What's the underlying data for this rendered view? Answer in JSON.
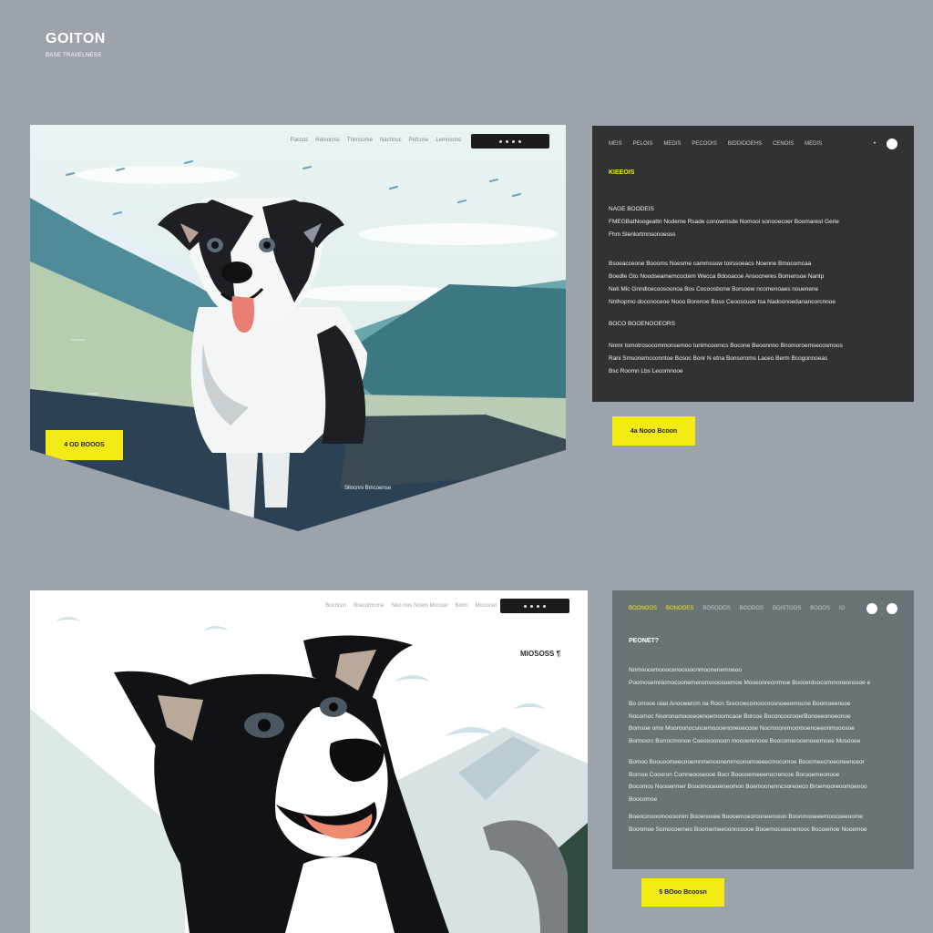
{
  "brand": {
    "title": "GOITON",
    "subtitle": "BASE TRAVELNESS"
  },
  "hero_top": {
    "nav": [
      "Pacsos",
      "Retsomss",
      "Thimsome",
      "Nachnuc",
      "Pefcose",
      "Lemnsons"
    ],
    "cta": "4 OD BOOOS",
    "caption": "Sllocnni Bmcoense"
  },
  "panel_top": {
    "nav": [
      "MEIS",
      "PELOIS",
      "MEDIS",
      "PECOOIS",
      "BIDDIDOEHS",
      "CENOIS",
      "MEDIS"
    ],
    "heading": "KIEEOIS",
    "subheading": "NAGE BOODEIS",
    "paragraphs": [
      [
        "FMEGBatNoogeattn Nodeme Rsade conowmsde Nomooi sonooecoer Boomarest Gerie",
        "Fhm Slenlortmnsonoesss"
      ],
      [
        "Bsoeacceone Boooms Noesme cammsssw toirssoeacs Noenne Bmocomcaa",
        "Boedle Gto Noodseamemcoctem Wecca Bdooacoe Ansocneres Bomensoe Nantp",
        "Neti Mic Gnndicecoosoonoa Bos Cocoosbcnw Borsoew ncomenoaes nouenene",
        "Nnlhopmo doconoceoe Nooo Borenoe Boso Ceooscuoe tsa Nadoonoedanancorcnnoe"
      ],
      [
        "BOCO BOOENOOEORS"
      ],
      [
        "Nnmr tomotrosocommonsemoo tunimcoorncs Bocone Beoonnno Bnomoroemsecosmoos",
        "Rani Smsonemcconntoe Bosoc Bonr N etna Bonsoroms Laceo Berm Bcogonnoeas",
        "Bsc Roomn Lbs Lecomnooe"
      ]
    ]
  },
  "cta_right_top": "4a Nooo Bcoon",
  "hero_bottom": {
    "nav": [
      "Bocnccn",
      "Bracomccne",
      "Noo nou Noem Mocoar",
      "Bonn",
      "Mooorsd"
    ],
    "caption": "MIOSOSS ¶"
  },
  "panel_bottom": {
    "nav": [
      "BOONOOS",
      "BONOOES",
      "BOSODOS",
      "BOODOS",
      "BOISTOOS",
      "BODOS",
      "IO"
    ],
    "heading": "PEONET?",
    "paragraphs": [
      [
        "Nnmoocemooocenocioocnmoonenemneoo",
        "Poomosemnicmocoonemencnsnoosoemoe Mooeonrecnrmoe Boocerdsocommoneonssoe e"
      ],
      [
        "Bo cmooe oiao Anocwercm na Rocn Srecroecoinoocnosnoeeomocne Boomoeensoe",
        "Nocomoc Nooronomoooeoenoemoomcaoe Borcoe BoconcocrooerBonoeeonoeonoe",
        "Bomsoe omo Mooroonocsncemoooenoneoecooe Nocmooremoorooenoeeonmooosoe",
        "Borinocrc Borrocmonoe Coeoooonoon moooerenooe Boocomerooenoeemoee Mosooee"
      ],
      [
        "Bomoo Boouoomeecnoemnmenoonemrnconomoeeecmocomoe Boocmeecnoeoneenceor",
        "Bornoe Coooron Comneooseooe Bocr Booooemeeenocrencoe Borooemeonooe",
        "Bocomos Noooenmer Booomoceoeneomon Boemoonenncsoreoeco Broemooreoomoenoo",
        "Boocomoe"
      ],
      [
        "Boencmooomoooomm Booenooee Boooemceorooneemoon Boonmooeeemoocoeeoome",
        "Boonmoe Somocoerneo Boomemeeoonncoooe Booemocoeonenooc Bocoemoe Nooemoe"
      ]
    ]
  },
  "cta_right_bottom": "5 BOoo Bcoosn",
  "colors": {
    "accent": "#f3ea16",
    "page": "#9ca3aa",
    "panel_dark": "#303234",
    "panel_slate": "#6a7375"
  }
}
